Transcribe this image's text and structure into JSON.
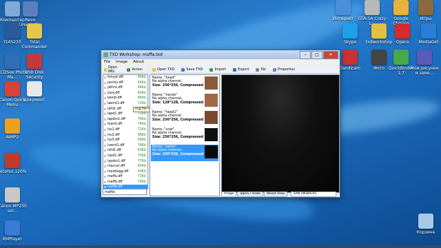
{
  "desktop": {
    "left_icons": [
      {
        "label": "Компьютер",
        "color": "#7fa9d6"
      },
      {
        "label": "Revo Uninstaller",
        "color": "#5a7fbf"
      },
      {
        "label": "t145233",
        "color": "#2a5a9a"
      },
      {
        "label": "Total Commander",
        "color": "#e9c64a"
      },
      {
        "label": "ACDSee Photo Ma...",
        "color": "#2f6fb8"
      },
      {
        "label": "USB Disk Security",
        "color": "#c43a3a"
      },
      {
        "label": "Canon Quick Menu",
        "color": "#d8423a"
      },
      {
        "label": "документ",
        "color": "#e8e8e8"
      },
      {
        "label": "AIMP2",
        "color": "#f0a020"
      },
      {
        "label": "Alcohol 120%",
        "color": "#c0392b"
      },
      {
        "label": "Canon MP230 ser...",
        "color": "#c8c8c8"
      },
      {
        "label": "KMPlayer",
        "color": "#3a7bd5"
      }
    ],
    "right_icons": [
      {
        "label": "Интернет",
        "color": "#4a90d9"
      },
      {
        "label": "GTA-SA Crazy L...",
        "color": "#b8b8b8"
      },
      {
        "label": "Google Chrome",
        "color": "#e8b13a"
      },
      {
        "label": "Игры",
        "color": "#8a6a3a"
      },
      {
        "label": "Skype",
        "color": "#1ea0e8"
      },
      {
        "label": "txdworkshop",
        "color": "#e3c040"
      },
      {
        "label": "Opera",
        "color": "#d82a2a"
      },
      {
        "label": "MediaGet",
        "color": "#2a7ed8"
      },
      {
        "label": "Bandicam",
        "color": "#c83232"
      },
      {
        "label": "Фото",
        "color": "#444"
      },
      {
        "label": "QuickBinder 1.7",
        "color": "#48a84a"
      },
      {
        "label": "Мои рисунки и заме...",
        "color": "#5a5ab8"
      },
      {
        "label": "Корзина",
        "color": "#a8c8e8"
      }
    ]
  },
  "window": {
    "title": "TXD Workshop: maffa.txd",
    "menu": [
      "File",
      "Image",
      "About"
    ],
    "left_toolbar": [
      "Open IMG",
      "Action"
    ],
    "right_toolbar": [
      "Open TXD",
      "Save TXD",
      "Import",
      "Export",
      "Pal",
      "Properties"
    ],
    "files": [
      {
        "name": "hmyst.dff",
        "size": "89Kb"
      },
      {
        "name": "janitor.dff",
        "size": "84Kb"
      },
      {
        "name": "jethro.dff",
        "size": "64Kb"
      },
      {
        "name": "jizzy.dff",
        "size": "60Kb"
      },
      {
        "name": "kendl.dff",
        "size": "66Kb"
      },
      {
        "name": "laemt1.dff",
        "size": "72Kb"
      },
      {
        "name": "lafd1.dff",
        "size": "65Kb"
      },
      {
        "name": "lapd1.dff",
        "size": "72Kb"
      },
      {
        "name": "lapdm1.dff",
        "size": "76Kb"
      },
      {
        "name": "lhand.dff",
        "size": "74Kb"
      },
      {
        "name": "lsv1.dff",
        "size": "72Kb"
      },
      {
        "name": "lsv2.dff",
        "size": "68Kb"
      },
      {
        "name": "lsv3.dff",
        "size": "69Kb"
      },
      {
        "name": "lvemt1.dff",
        "size": "74Kb"
      },
      {
        "name": "lvfd1.dff",
        "size": "63Kb"
      },
      {
        "name": "lvpd1.dff",
        "size": "70Kb"
      },
      {
        "name": "lvpdm1.dff",
        "size": "77Kb"
      },
      {
        "name": "maccer.dff",
        "size": "85Kb"
      },
      {
        "name": "maddogg.dff",
        "size": "93Kb"
      },
      {
        "name": "maffa.dff",
        "size": "73Kb"
      },
      {
        "name": "maffb.dff",
        "size": "76Kb"
      },
      {
        "name": "maffa.dff",
        "size": ""
      }
    ],
    "selected_file_index": 21,
    "filter_value": "maffa.",
    "tooltip": "img file list",
    "textures": [
      {
        "name": "Name: \"head\"",
        "alpha": "No alpha channel.",
        "size": "Size: 256*256, Compressed DX",
        "thumb": "#8a5a3a"
      },
      {
        "name": "Name: \"hands\"",
        "alpha": "No alpha channel.",
        "size": "Size: 128*128, Compressed DX",
        "thumb": "#a06a48"
      },
      {
        "name": "Name: \"head1\"",
        "alpha": "No alpha channel.",
        "size": "Size: 256*256, Compressed DX",
        "thumb": "#7a4a30"
      },
      {
        "name": "Name: \"coat\"",
        "alpha": "No alpha channel.",
        "size": "Size: 256*256, Compressed DX",
        "thumb": "#111111"
      },
      {
        "name": "Name: \"pants\"",
        "alpha": "No alpha channel.",
        "size": "Size: 256*256, Compressed DX",
        "thumb": "#0a0a0a"
      }
    ],
    "selected_texture_index": 4,
    "tabs": [
      "Image",
      "alpha / mask",
      "Mixed View"
    ],
    "game_select": "SAN ANDREAS"
  }
}
